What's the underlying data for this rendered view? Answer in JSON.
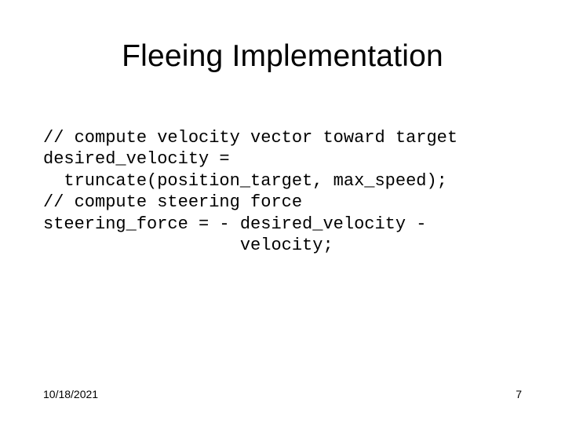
{
  "slide": {
    "title": "Fleeing Implementation",
    "code_lines": [
      "// compute velocity vector toward target",
      "desired_velocity =",
      "  truncate(position_target, max_speed);",
      "// compute steering force",
      "steering_force = - desired_velocity -",
      "                   velocity;"
    ],
    "footer": {
      "date": "10/18/2021",
      "page": "7"
    }
  }
}
